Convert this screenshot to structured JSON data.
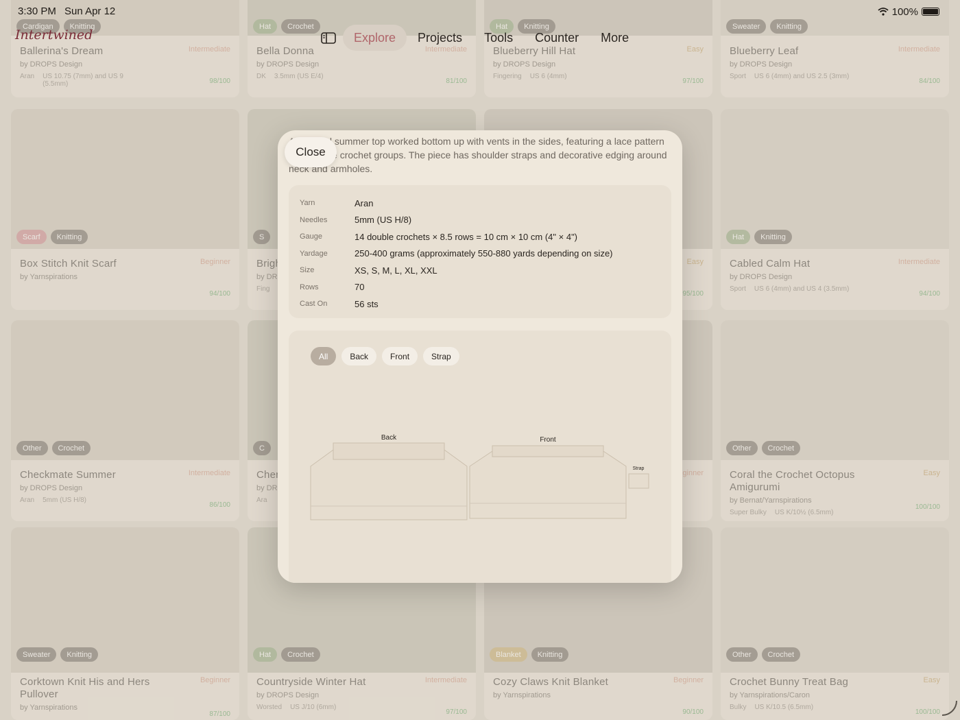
{
  "status_bar": {
    "time": "3:30 PM",
    "date": "Sun Apr 12",
    "battery": "100%"
  },
  "app": {
    "logo": "Intertwined"
  },
  "nav": {
    "tabs": [
      {
        "label": "Explore",
        "active": true
      },
      {
        "label": "Projects",
        "active": false
      },
      {
        "label": "Tools",
        "active": false
      },
      {
        "label": "Counter",
        "active": false
      },
      {
        "label": "More",
        "active": false
      }
    ]
  },
  "cards": [
    {
      "title": "Ballerina's Dream",
      "level": "Intermediate",
      "by": "by DROPS Design",
      "weight": "Aran",
      "needle": "US 10.75 (7mm) and US 9 (5.5mm)",
      "score": "98/100",
      "tags": [
        "Cardigan",
        "Knitting"
      ]
    },
    {
      "title": "Bella Donna",
      "level": "Intermediate",
      "by": "by DROPS Design",
      "weight": "DK",
      "needle": "3.5mm (US E/4)",
      "score": "81/100",
      "tags": [
        "Hat",
        "Crochet"
      ]
    },
    {
      "title": "Blueberry Hill Hat",
      "level": "Easy",
      "by": "by DROPS Design",
      "weight": "Fingering",
      "needle": "US 6 (4mm)",
      "score": "97/100",
      "tags": [
        "Hat",
        "Knitting"
      ]
    },
    {
      "title": "Blueberry Leaf",
      "level": "Intermediate",
      "by": "by DROPS Design",
      "weight": "Sport",
      "needle": "US 6 (4mm) and US 2.5 (3mm)",
      "score": "84/100",
      "tags": [
        "Sweater",
        "Knitting"
      ]
    },
    {
      "title": "Box Stitch Knit Scarf",
      "level": "Beginner",
      "by": "by Yarnspirations",
      "weight": "",
      "needle": "",
      "score": "94/100",
      "tags": [
        "Scarf",
        "Knitting"
      ]
    },
    {
      "title": "Bright",
      "level": "",
      "by": "by DR",
      "weight": "Fing",
      "needle": "",
      "score": "",
      "tags": [
        "S"
      ]
    },
    {
      "title": "",
      "level": "Easy",
      "by": "",
      "weight": "",
      "needle": "",
      "score": "95/100",
      "tags": []
    },
    {
      "title": "Cabled Calm Hat",
      "level": "Intermediate",
      "by": "by DROPS Design",
      "weight": "Sport",
      "needle": "US 6 (4mm) and US 4 (3.5mm)",
      "score": "94/100",
      "tags": [
        "Hat",
        "Knitting"
      ]
    },
    {
      "title": "Checkmate Summer",
      "level": "Intermediate",
      "by": "by DROPS Design",
      "weight": "Aran",
      "needle": "5mm (US H/8)",
      "score": "86/100",
      "tags": [
        "Other",
        "Crochet"
      ]
    },
    {
      "title": "Cher",
      "level": "",
      "by": "by DR",
      "weight": "Ara",
      "needle": "",
      "score": "",
      "tags": [
        "C"
      ]
    },
    {
      "title": "",
      "level": "Beginner",
      "by": "",
      "weight": "",
      "needle": "",
      "score": "",
      "tags": []
    },
    {
      "title": "Coral the Crochet Octopus Amigurumi",
      "level": "Easy",
      "by": "by Bernat/Yarnspirations",
      "weight": "Super Bulky",
      "needle": "US K/10½ (6.5mm)",
      "score": "100/100",
      "tags": [
        "Other",
        "Crochet"
      ]
    },
    {
      "title": "Corktown Knit His and Hers Pullover",
      "level": "Beginner",
      "by": "by Yarnspirations",
      "weight": "",
      "needle": "",
      "score": "87/100",
      "tags": [
        "Sweater",
        "Knitting"
      ]
    },
    {
      "title": "Countryside Winter Hat",
      "level": "Intermediate",
      "by": "by DROPS Design",
      "weight": "Worsted",
      "needle": "US J/10 (6mm)",
      "score": "97/100",
      "tags": [
        "Hat",
        "Crochet"
      ]
    },
    {
      "title": "Cozy Claws Knit Blanket",
      "level": "Beginner",
      "by": "by Yarnspirations",
      "weight": "",
      "needle": "",
      "score": "90/100",
      "tags": [
        "Blanket",
        "Knitting"
      ]
    },
    {
      "title": "Crochet Bunny Treat Bag",
      "level": "Easy",
      "by": "by Yarnspirations/Caron",
      "weight": "Bulky",
      "needle": "US K/10.5 (6.5mm)",
      "score": "100/100",
      "tags": [
        "Other",
        "Crochet"
      ]
    }
  ],
  "modal": {
    "close_label": "Close",
    "description": "A textured summer top worked bottom up with vents in the sides, featuring a lace pattern with double crochet groups. The piece has shoulder straps and decorative edging around neck and armholes.",
    "specs": [
      {
        "key": "Yarn",
        "value": "Aran"
      },
      {
        "key": "Needles",
        "value": "5mm (US H/8)"
      },
      {
        "key": "Gauge",
        "value": "14 double crochets × 8.5 rows = 10 cm × 10 cm (4\" × 4\")"
      },
      {
        "key": "Yardage",
        "value": "250-400 grams (approximately 550-880 yards depending on size)"
      },
      {
        "key": "Size",
        "value": "XS, S, M, L, XL, XXL"
      },
      {
        "key": "Rows",
        "value": "70"
      },
      {
        "key": "Cast On",
        "value": "56 sts"
      }
    ],
    "filters": [
      {
        "label": "All",
        "active": true
      },
      {
        "label": "Back",
        "active": false
      },
      {
        "label": "Front",
        "active": false
      },
      {
        "label": "Strap",
        "active": false
      }
    ],
    "pieces": {
      "back": "Back",
      "front": "Front",
      "strap": "Strap"
    }
  }
}
